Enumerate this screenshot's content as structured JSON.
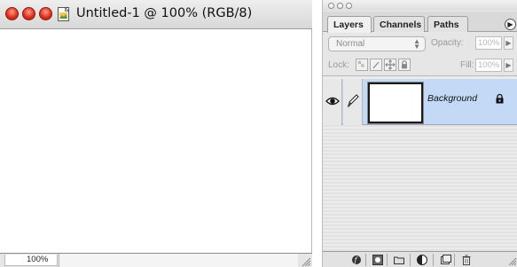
{
  "document": {
    "title": "Untitled-1 @ 100% (RGB/8)",
    "zoom_level": "100%"
  },
  "palette": {
    "tabs": [
      {
        "label": "Layers",
        "active": true
      },
      {
        "label": "Channels",
        "active": false
      },
      {
        "label": "Paths",
        "active": false
      }
    ],
    "blend_mode": "Normal",
    "opacity_label": "Opacity:",
    "opacity_value": "100%",
    "lock_label": "Lock:",
    "fill_label": "Fill:",
    "fill_value": "100%",
    "layers": [
      {
        "name": "Background",
        "visible": true,
        "locked": true,
        "selected": true
      }
    ],
    "bottom_buttons": [
      "layer-style-icon",
      "layer-mask-icon",
      "new-set-icon",
      "adjustment-layer-icon",
      "new-layer-icon",
      "trash-icon"
    ]
  },
  "colors": {
    "selection": "#c3d9f6",
    "traffic_red": "#e0331d"
  }
}
